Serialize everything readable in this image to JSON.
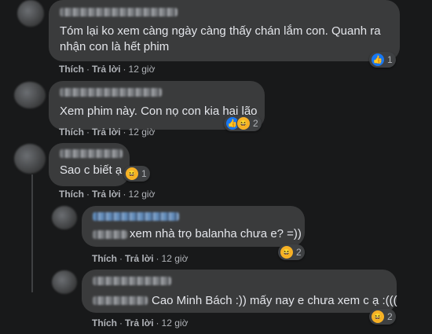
{
  "comments": [
    {
      "lines": [
        "Tóm lại ko xem càng ngày càng thấy chán lắm con. Quanh ra",
        "nhận con là hết phim"
      ],
      "like_label": "Thích",
      "reply_label": "Trả lời",
      "time": "12 giờ",
      "reaction_icons": [
        "like-icon"
      ],
      "reaction_count": "1"
    },
    {
      "lines": [
        "Xem phim này. Con nọ con kia hại lão"
      ],
      "like_label": "Thích",
      "reply_label": "Trả lời",
      "time": "12 giờ",
      "reaction_icons": [
        "like-icon",
        "haha-icon"
      ],
      "reaction_count": "2"
    },
    {
      "lines": [
        "Sao c biết ạ"
      ],
      "like_label": "Thích",
      "reply_label": "Trả lời",
      "time": "12 giờ",
      "reaction_icons": [
        "haha-icon"
      ],
      "reaction_count": "1"
    },
    {
      "lines": [
        "xem nhà trọ balanha chưa e? =))"
      ],
      "like_label": "Thích",
      "reply_label": "Trả lời",
      "time": "12 giờ",
      "reaction_icons": [
        "haha-icon"
      ],
      "reaction_count": "2"
    },
    {
      "lines": [
        "Cao Minh Bách :)) mấy nay e chưa xem c ạ :((("
      ],
      "like_label": "Thích",
      "reply_label": "Trả lời",
      "time": "12 giờ",
      "reaction_icons": [
        "haha-icon"
      ],
      "reaction_count": "2"
    }
  ],
  "colors": {
    "background": "#18191a",
    "bubble": "#3a3b3c",
    "text": "#e4e6eb",
    "secondary_text": "#b0b3b8",
    "like_blue": "#1877f2",
    "haha_yellow": "#f7b125"
  }
}
